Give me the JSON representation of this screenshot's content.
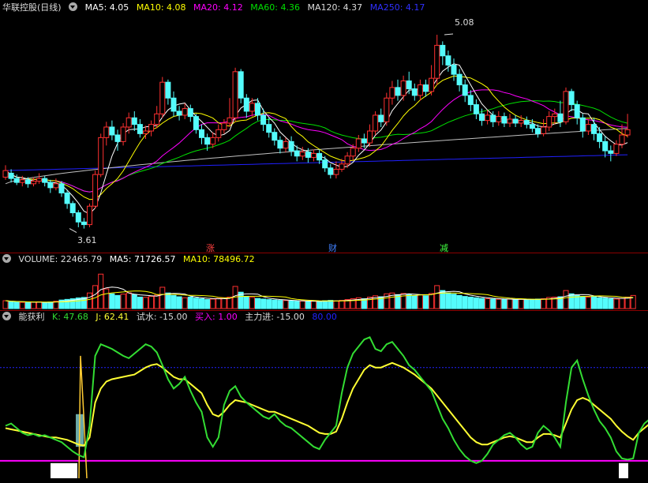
{
  "colors": {
    "up": "#ff3030",
    "down": "#54fcfc",
    "ma5": "#ffffff",
    "ma10": "#ffff00",
    "ma20": "#ff00ff",
    "ma60": "#00e000",
    "ma120": "#c0c0c0",
    "ma250": "#2020ff",
    "k": "#33dd33",
    "j": "#ffff33",
    "zhuli": "#ff00ff",
    "ref": "#2222ff"
  },
  "price_panel": {
    "stock_name": "华联控股(日线)",
    "ma_labels": {
      "ma5": "MA5: 4.05",
      "ma10": "MA10: 4.08",
      "ma20": "MA20: 4.12",
      "ma60": "MA60: 4.36",
      "ma120": "MA120: 4.37",
      "ma250": "MA250: 4.17"
    },
    "high_label": "5.08",
    "low_label": "3.61",
    "events": {
      "zhang": "涨",
      "cai": "财",
      "jian": "减"
    }
  },
  "volume_panel": {
    "volume_label": "VOLUME: 22465.79",
    "ma5_label": "MA5: 71726.57",
    "ma10_label": "MA10: 78496.72"
  },
  "indicator_panel": {
    "name": "能获利",
    "k_label": "K: 47.68",
    "j_label": "J: 62.41",
    "shishui_label": "试水: -15.00",
    "mairu_label": "买入: 1.00",
    "zhuli_label": "主力进: -15.00",
    "level_label": "80.00"
  },
  "chart_data": [
    {
      "type": "candlestick",
      "title": "华联控股(日线)",
      "ylim": [
        3.5,
        5.2
      ],
      "high": 5.08,
      "low": 3.61,
      "candles": [
        [
          4.0,
          4.05,
          3.98,
          4.09
        ],
        [
          4.03,
          3.99,
          3.96,
          4.06
        ],
        [
          3.99,
          3.96,
          3.94,
          4.02
        ],
        [
          3.96,
          3.98,
          3.93,
          4.01
        ],
        [
          3.98,
          3.95,
          3.92,
          4.0
        ],
        [
          3.95,
          3.97,
          3.93,
          4.0
        ],
        [
          3.97,
          3.99,
          3.95,
          4.03
        ],
        [
          3.99,
          3.96,
          3.93,
          4.01
        ],
        [
          3.96,
          3.92,
          3.88,
          3.98
        ],
        [
          3.92,
          3.95,
          3.9,
          3.99
        ],
        [
          3.95,
          3.88,
          3.85,
          3.97
        ],
        [
          3.88,
          3.8,
          3.76,
          3.9
        ],
        [
          3.8,
          3.73,
          3.7,
          3.82
        ],
        [
          3.73,
          3.66,
          3.62,
          3.75
        ],
        [
          3.66,
          3.64,
          3.61,
          3.69
        ],
        [
          3.64,
          3.78,
          3.62,
          3.8
        ],
        [
          3.78,
          4.02,
          3.76,
          4.05
        ],
        [
          4.02,
          4.3,
          4.0,
          4.33
        ],
        [
          4.3,
          4.38,
          4.24,
          4.42
        ],
        [
          4.38,
          4.32,
          4.28,
          4.43
        ],
        [
          4.32,
          4.27,
          4.2,
          4.36
        ],
        [
          4.27,
          4.38,
          4.24,
          4.41
        ],
        [
          4.38,
          4.45,
          4.33,
          4.49
        ],
        [
          4.45,
          4.4,
          4.35,
          4.5
        ],
        [
          4.4,
          4.33,
          4.3,
          4.44
        ],
        [
          4.33,
          4.35,
          4.29,
          4.39
        ],
        [
          4.35,
          4.4,
          4.31,
          4.43
        ],
        [
          4.4,
          4.48,
          4.37,
          4.54
        ],
        [
          4.48,
          4.72,
          4.45,
          4.76
        ],
        [
          4.72,
          4.6,
          4.55,
          4.74
        ],
        [
          4.6,
          4.5,
          4.46,
          4.65
        ],
        [
          4.5,
          4.47,
          4.43,
          4.54
        ],
        [
          4.47,
          4.52,
          4.44,
          4.56
        ],
        [
          4.52,
          4.46,
          4.42,
          4.55
        ],
        [
          4.46,
          4.36,
          4.33,
          4.48
        ],
        [
          4.36,
          4.3,
          4.25,
          4.4
        ],
        [
          4.3,
          4.25,
          4.2,
          4.33
        ],
        [
          4.25,
          4.3,
          4.22,
          4.34
        ],
        [
          4.3,
          4.36,
          4.27,
          4.4
        ],
        [
          4.36,
          4.41,
          4.33,
          4.44
        ],
        [
          4.41,
          4.45,
          4.38,
          4.6
        ],
        [
          4.45,
          4.8,
          4.42,
          4.83
        ],
        [
          4.8,
          4.6,
          4.56,
          4.82
        ],
        [
          4.6,
          4.5,
          4.45,
          4.63
        ],
        [
          4.5,
          4.56,
          4.46,
          4.6
        ],
        [
          4.56,
          4.47,
          4.43,
          4.6
        ],
        [
          4.47,
          4.4,
          4.35,
          4.52
        ],
        [
          4.4,
          4.34,
          4.3,
          4.45
        ],
        [
          4.34,
          4.28,
          4.24,
          4.37
        ],
        [
          4.28,
          4.22,
          4.18,
          4.31
        ],
        [
          4.22,
          4.27,
          4.19,
          4.3
        ],
        [
          4.27,
          4.2,
          4.16,
          4.31
        ],
        [
          4.2,
          4.16,
          4.12,
          4.24
        ],
        [
          4.16,
          4.19,
          4.13,
          4.23
        ],
        [
          4.19,
          4.15,
          4.11,
          4.22
        ],
        [
          4.15,
          4.18,
          4.12,
          4.21
        ],
        [
          4.18,
          4.13,
          4.1,
          4.21
        ],
        [
          4.13,
          4.07,
          4.04,
          4.16
        ],
        [
          4.07,
          4.02,
          3.99,
          4.1
        ],
        [
          4.02,
          4.06,
          3.99,
          4.12
        ],
        [
          4.06,
          4.1,
          4.04,
          4.14
        ],
        [
          4.1,
          4.16,
          4.07,
          4.19
        ],
        [
          4.16,
          4.22,
          4.13,
          4.25
        ],
        [
          4.22,
          4.29,
          4.19,
          4.32
        ],
        [
          4.29,
          4.26,
          4.22,
          4.33
        ],
        [
          4.26,
          4.35,
          4.23,
          4.4
        ],
        [
          4.35,
          4.47,
          4.32,
          4.5
        ],
        [
          4.47,
          4.42,
          4.38,
          4.52
        ],
        [
          4.42,
          4.6,
          4.39,
          4.64
        ],
        [
          4.6,
          4.68,
          4.55,
          4.73
        ],
        [
          4.68,
          4.62,
          4.58,
          4.74
        ],
        [
          4.62,
          4.73,
          4.58,
          4.77
        ],
        [
          4.73,
          4.67,
          4.63,
          4.8
        ],
        [
          4.67,
          4.62,
          4.58,
          4.71
        ],
        [
          4.62,
          4.7,
          4.58,
          4.74
        ],
        [
          4.7,
          4.65,
          4.61,
          4.74
        ],
        [
          4.65,
          4.75,
          4.62,
          4.85
        ],
        [
          4.75,
          5.0,
          4.7,
          5.08
        ],
        [
          5.0,
          4.92,
          4.85,
          5.03
        ],
        [
          4.92,
          4.85,
          4.8,
          4.96
        ],
        [
          4.85,
          4.78,
          4.73,
          4.9
        ],
        [
          4.78,
          4.7,
          4.65,
          4.82
        ],
        [
          4.7,
          4.62,
          4.57,
          4.74
        ],
        [
          4.62,
          4.55,
          4.5,
          4.66
        ],
        [
          4.55,
          4.48,
          4.44,
          4.59
        ],
        [
          4.48,
          4.43,
          4.39,
          4.52
        ],
        [
          4.43,
          4.47,
          4.4,
          4.51
        ],
        [
          4.47,
          4.42,
          4.38,
          4.5
        ],
        [
          4.42,
          4.46,
          4.39,
          4.5
        ],
        [
          4.46,
          4.41,
          4.38,
          4.49
        ],
        [
          4.41,
          4.44,
          4.38,
          4.48
        ],
        [
          4.44,
          4.41,
          4.38,
          4.47
        ],
        [
          4.41,
          4.43,
          4.38,
          4.47
        ],
        [
          4.43,
          4.4,
          4.37,
          4.46
        ],
        [
          4.4,
          4.37,
          4.34,
          4.44
        ],
        [
          4.37,
          4.33,
          4.3,
          4.4
        ],
        [
          4.33,
          4.38,
          4.31,
          4.44
        ],
        [
          4.38,
          4.46,
          4.35,
          4.5
        ],
        [
          4.46,
          4.48,
          4.4,
          4.52
        ],
        [
          4.48,
          4.42,
          4.38,
          4.58
        ],
        [
          4.42,
          4.65,
          4.4,
          4.68
        ],
        [
          4.65,
          4.55,
          4.5,
          4.67
        ],
        [
          4.55,
          4.45,
          4.4,
          4.58
        ],
        [
          4.45,
          4.35,
          4.3,
          4.48
        ],
        [
          4.35,
          4.4,
          4.32,
          4.44
        ],
        [
          4.4,
          4.33,
          4.28,
          4.45
        ],
        [
          4.33,
          4.27,
          4.22,
          4.38
        ],
        [
          4.27,
          4.2,
          4.15,
          4.31
        ],
        [
          4.2,
          4.18,
          4.12,
          4.24
        ],
        [
          4.18,
          4.25,
          4.16,
          4.28
        ],
        [
          4.25,
          4.32,
          4.22,
          4.4
        ],
        [
          4.32,
          4.36,
          4.3,
          4.48
        ]
      ],
      "ma_last": {
        "ma5": 4.05,
        "ma10": 4.08,
        "ma20": 4.12,
        "ma60": 4.36,
        "ma120": 4.37,
        "ma250": 4.17
      }
    },
    {
      "type": "bar",
      "title": "VOLUME",
      "ylim": [
        0,
        250000
      ],
      "values": [
        48000,
        42000,
        40000,
        38000,
        36000,
        39000,
        41000,
        37000,
        40000,
        45000,
        52000,
        56000,
        60000,
        65000,
        68000,
        95000,
        140000,
        210000,
        120000,
        90000,
        80000,
        88000,
        96000,
        85000,
        70000,
        68000,
        74000,
        82000,
        130000,
        95000,
        80000,
        72000,
        66000,
        70000,
        64000,
        60000,
        55000,
        58000,
        62000,
        66000,
        70000,
        135000,
        100000,
        75000,
        68000,
        62000,
        58000,
        55000,
        52000,
        50000,
        49000,
        47000,
        45000,
        46000,
        44000,
        45000,
        43000,
        48000,
        50000,
        46000,
        50000,
        55000,
        60000,
        66000,
        60000,
        70000,
        78000,
        72000,
        90000,
        95000,
        85000,
        92000,
        88000,
        80000,
        84000,
        78000,
        92000,
        140000,
        110000,
        96000,
        88000,
        80000,
        74000,
        70000,
        66000,
        62000,
        60000,
        58000,
        57000,
        56000,
        58000,
        55000,
        57000,
        54000,
        56000,
        58000,
        60000,
        68000,
        70000,
        72000,
        110000,
        90000,
        80000,
        74000,
        70000,
        72000,
        66000,
        64000,
        60000,
        58000,
        62000,
        70000,
        80000
      ],
      "ma5_last": 71726.57,
      "ma10_last": 78496.72
    },
    {
      "type": "line",
      "title": "能获利",
      "ylim": [
        -15,
        115
      ],
      "reference_level": 80,
      "series": [
        {
          "name": "K",
          "values": [
            30,
            32,
            28,
            24,
            22,
            23,
            21,
            22,
            20,
            18,
            16,
            12,
            8,
            5,
            3,
            30,
            90,
            100,
            98,
            96,
            93,
            90,
            88,
            92,
            96,
            100,
            98,
            93,
            82,
            70,
            62,
            66,
            72,
            60,
            50,
            42,
            20,
            12,
            20,
            48,
            60,
            64,
            55,
            50,
            46,
            42,
            38,
            36,
            40,
            34,
            30,
            28,
            24,
            20,
            16,
            12,
            10,
            18,
            24,
            30,
            58,
            80,
            92,
            98,
            104,
            106,
            96,
            94,
            100,
            102,
            96,
            90,
            82,
            78,
            72,
            66,
            60,
            48,
            36,
            28,
            18,
            10,
            4,
            0,
            -2,
            0,
            6,
            14,
            18,
            22,
            24,
            20,
            14,
            10,
            12,
            24,
            30,
            26,
            20,
            12,
            50,
            80,
            86,
            70,
            56,
            44,
            34,
            28,
            20,
            8,
            2,
            1,
            2,
            24,
            32,
            36,
            40,
            56,
            62
          ]
        },
        {
          "name": "J",
          "values": [
            28,
            27,
            26,
            25,
            24,
            23,
            22,
            21,
            20,
            20,
            19,
            18,
            16,
            14,
            13,
            20,
            50,
            62,
            68,
            70,
            71,
            72,
            73,
            74,
            77,
            80,
            82,
            83,
            80,
            76,
            72,
            70,
            70,
            66,
            62,
            58,
            48,
            40,
            38,
            42,
            48,
            52,
            51,
            50,
            48,
            46,
            44,
            42,
            42,
            40,
            38,
            36,
            34,
            32,
            30,
            27,
            24,
            23,
            23,
            25,
            36,
            50,
            62,
            70,
            78,
            82,
            80,
            80,
            82,
            84,
            82,
            80,
            77,
            74,
            70,
            66,
            62,
            56,
            50,
            44,
            38,
            32,
            26,
            20,
            16,
            14,
            14,
            16,
            18,
            20,
            21,
            20,
            18,
            16,
            16,
            20,
            23,
            23,
            22,
            20,
            32,
            44,
            52,
            54,
            52,
            48,
            44,
            40,
            36,
            30,
            25,
            21,
            18,
            24,
            28,
            32,
            36,
            44,
            50
          ]
        }
      ],
      "signals": [
        {
          "name": "试水",
          "value": -15.0
        },
        {
          "name": "买入",
          "value": 1.0
        },
        {
          "name": "主力进",
          "value": -15.0
        }
      ]
    }
  ]
}
